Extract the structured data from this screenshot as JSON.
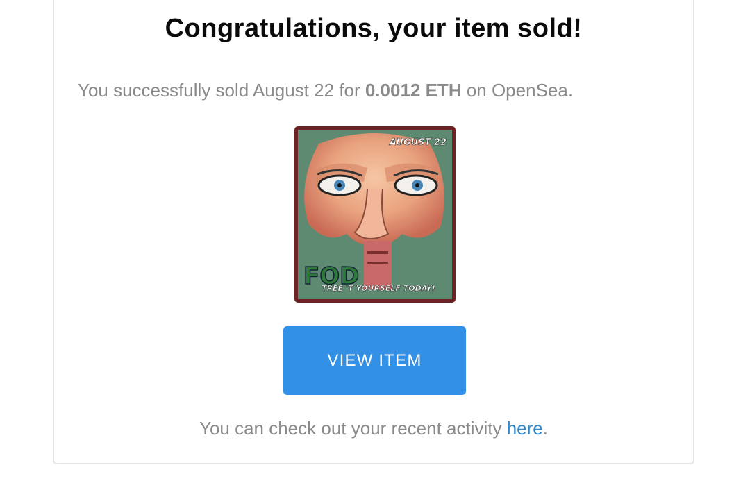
{
  "email": {
    "title": "Congratulations, your item sold!",
    "sold_prefix": "You successfully sold August 22 for ",
    "price": "0.0012 ETH",
    "sold_suffix": " on OpenSea.",
    "item_image": {
      "top_caption": "AUGUST 22",
      "bottom_caption": "TREE 'T YOURSELF TODAY!",
      "frame_color": "#6b2325"
    },
    "view_button_label": "VIEW ITEM",
    "activity_prefix": "You can check out your recent activity ",
    "activity_link": "here",
    "activity_suffix": "."
  },
  "colors": {
    "button": "#3291e6",
    "link": "#2f86c9",
    "muted_text": "#8a8a8a",
    "border": "#e3e5e8"
  }
}
